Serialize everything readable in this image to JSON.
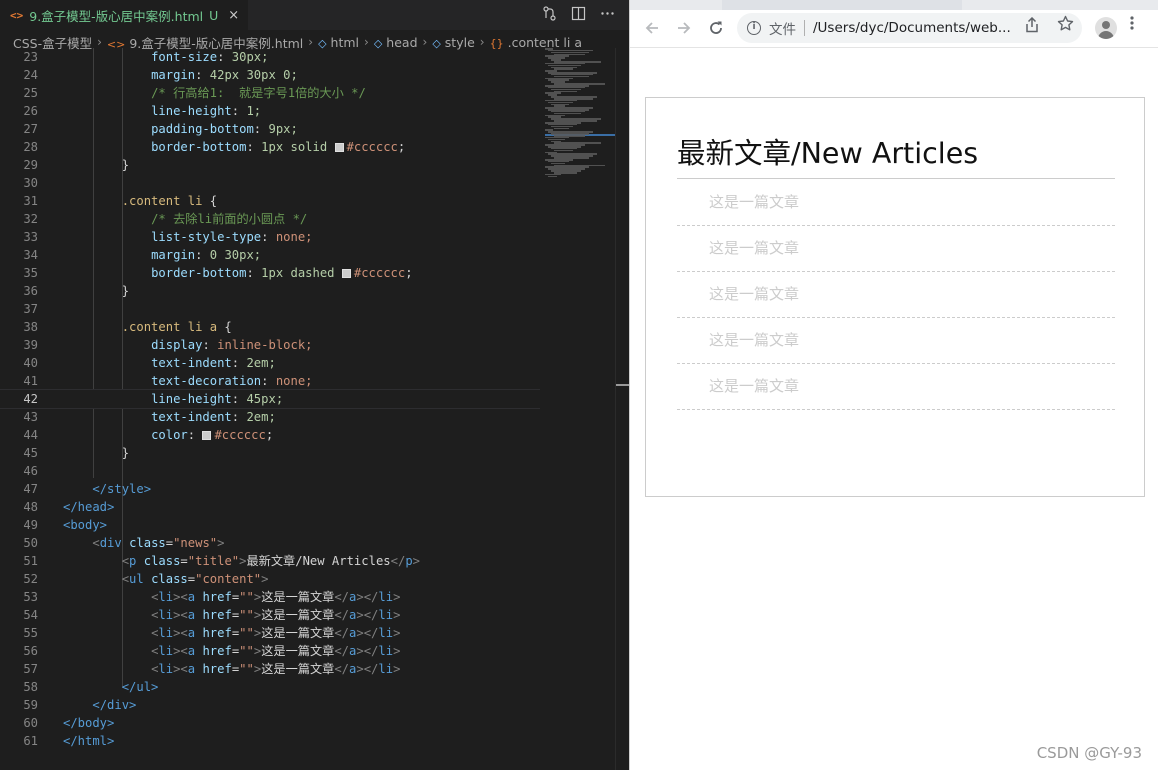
{
  "editor": {
    "tab": {
      "icon": "<>",
      "title": "9.盒子模型-版心居中案例.html",
      "badge": "U",
      "close": "×"
    },
    "breadcrumbs": [
      {
        "label": "CSS-盒子模型",
        "icon": ""
      },
      {
        "label": "9.盒子模型-版心居中案例.html",
        "icon": "<>"
      },
      {
        "label": "html",
        "icon": "◇"
      },
      {
        "label": "head",
        "icon": "◇"
      },
      {
        "label": "style",
        "icon": "◇"
      },
      {
        "label": ".content li a",
        "icon": "{}"
      }
    ],
    "current_line": 42,
    "lines": [
      {
        "n": 23,
        "indent": 3,
        "kind": "decl",
        "prop": "font-size",
        "val": "30px;"
      },
      {
        "n": 24,
        "indent": 3,
        "kind": "decl",
        "prop": "margin",
        "val": "42px 30px 0;"
      },
      {
        "n": 25,
        "indent": 3,
        "kind": "comment",
        "text": "/* 行高给1:  就是字号1倍的大小 */"
      },
      {
        "n": 26,
        "indent": 3,
        "kind": "decl",
        "prop": "line-height",
        "val": "1;"
      },
      {
        "n": 27,
        "indent": 3,
        "kind": "decl",
        "prop": "padding-bottom",
        "val": "9px;"
      },
      {
        "n": 28,
        "indent": 3,
        "kind": "decl",
        "prop": "border-bottom",
        "val": "1px solid ",
        "color": "#cccccc",
        "tail": ";"
      },
      {
        "n": 29,
        "indent": 2,
        "kind": "text",
        "text": "}"
      },
      {
        "n": 30,
        "indent": 0,
        "kind": "text",
        "text": ""
      },
      {
        "n": 31,
        "indent": 2,
        "kind": "sel",
        "text": ".content li",
        "tail": " {"
      },
      {
        "n": 32,
        "indent": 3,
        "kind": "comment",
        "text": "/* 去除li前面的小圆点 */"
      },
      {
        "n": 33,
        "indent": 3,
        "kind": "decl",
        "prop": "list-style-type",
        "val": "none;"
      },
      {
        "n": 34,
        "indent": 3,
        "kind": "decl",
        "prop": "margin",
        "val": "0 30px;"
      },
      {
        "n": 35,
        "indent": 3,
        "kind": "decl",
        "prop": "border-bottom",
        "val": "1px dashed ",
        "color": "#cccccc",
        "tail": ";"
      },
      {
        "n": 36,
        "indent": 2,
        "kind": "text",
        "text": "}"
      },
      {
        "n": 37,
        "indent": 0,
        "kind": "text",
        "text": ""
      },
      {
        "n": 38,
        "indent": 2,
        "kind": "sel",
        "text": ".content li a",
        "tail": " {"
      },
      {
        "n": 39,
        "indent": 3,
        "kind": "decl",
        "prop": "display",
        "val": "inline-block;"
      },
      {
        "n": 40,
        "indent": 3,
        "kind": "decl",
        "prop": "text-indent",
        "val": "2em;"
      },
      {
        "n": 41,
        "indent": 3,
        "kind": "decl",
        "prop": "text-decoration",
        "val": "none;"
      },
      {
        "n": 42,
        "indent": 3,
        "kind": "decl",
        "prop": "line-height",
        "val": "45px;"
      },
      {
        "n": 43,
        "indent": 3,
        "kind": "decl",
        "prop": "text-indent",
        "val": "2em;"
      },
      {
        "n": 44,
        "indent": 3,
        "kind": "decl",
        "prop": "color",
        "val": "",
        "color": "#cccccc",
        "tail": ";"
      },
      {
        "n": 45,
        "indent": 2,
        "kind": "text",
        "text": "}"
      },
      {
        "n": 46,
        "indent": 0,
        "kind": "text",
        "text": ""
      },
      {
        "n": 47,
        "indent": 1,
        "kind": "tag",
        "text": "</style>"
      },
      {
        "n": 48,
        "indent": 0,
        "kind": "tag",
        "text": "</head>"
      },
      {
        "n": 49,
        "indent": 0,
        "kind": "tag",
        "text": "<body>"
      },
      {
        "n": 50,
        "indent": 1,
        "kind": "opentag",
        "tag": "div",
        "attr": "class",
        "value": "news",
        "inner": "",
        "close": ""
      },
      {
        "n": 51,
        "indent": 2,
        "kind": "opentag",
        "tag": "p",
        "attr": "class",
        "value": "title",
        "inner": "最新文章/New Articles",
        "close": "p"
      },
      {
        "n": 52,
        "indent": 2,
        "kind": "opentag",
        "tag": "ul",
        "attr": "class",
        "value": "content",
        "inner": "",
        "close": ""
      },
      {
        "n": 53,
        "indent": 3,
        "kind": "li",
        "inner": "这是一篇文章"
      },
      {
        "n": 54,
        "indent": 3,
        "kind": "li",
        "inner": "这是一篇文章"
      },
      {
        "n": 55,
        "indent": 3,
        "kind": "li",
        "inner": "这是一篇文章"
      },
      {
        "n": 56,
        "indent": 3,
        "kind": "li",
        "inner": "这是一篇文章"
      },
      {
        "n": 57,
        "indent": 3,
        "kind": "li",
        "inner": "这是一篇文章"
      },
      {
        "n": 58,
        "indent": 2,
        "kind": "tag",
        "text": "</ul>"
      },
      {
        "n": 59,
        "indent": 1,
        "kind": "tag",
        "text": "</div>"
      },
      {
        "n": 60,
        "indent": 0,
        "kind": "tag",
        "text": "</body>"
      },
      {
        "n": 61,
        "indent": 0,
        "kind": "tag",
        "text": "</html>"
      }
    ]
  },
  "browser": {
    "icons": {
      "back": "back-arrow-icon",
      "forward": "forward-arrow-icon",
      "reload": "reload-icon",
      "info": "info-icon",
      "share": "share-icon",
      "star": "star-icon",
      "profile": "profile-icon",
      "menu": "menu-dots-icon"
    },
    "omnibox": {
      "label": "文件",
      "url": "/Users/dyc/Documents/web..."
    }
  },
  "page": {
    "title": "最新文章/New Articles",
    "items": [
      "这是一篇文章",
      "这是一篇文章",
      "这是一篇文章",
      "这是一篇文章",
      "这是一篇文章"
    ]
  },
  "watermark": "CSDN @GY-93",
  "colors": {
    "editor_bg": "#1e1e1e",
    "tab_modified": "#73c991",
    "border_gray": "#cccccc",
    "link_gray": "#cccccc"
  }
}
